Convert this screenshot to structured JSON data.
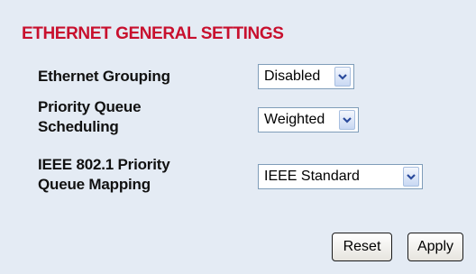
{
  "section": {
    "title": "ETHERNET GENERAL SETTINGS"
  },
  "settings": [
    {
      "label_lines": [
        "Ethernet Grouping"
      ],
      "value": "Disabled"
    },
    {
      "label_lines": [
        "Priority Queue",
        "Scheduling"
      ],
      "value": "Weighted"
    },
    {
      "label_lines": [
        "IEEE 802.1 Priority",
        "Queue Mapping"
      ],
      "value": "IEEE Standard"
    }
  ],
  "buttons": {
    "reset": "Reset",
    "apply": "Apply"
  },
  "colors": {
    "background": "#e4ebf4",
    "title": "#c8102e",
    "select_border": "#7f9db9"
  },
  "icons": {
    "dropdown": "chevron-down-icon"
  }
}
